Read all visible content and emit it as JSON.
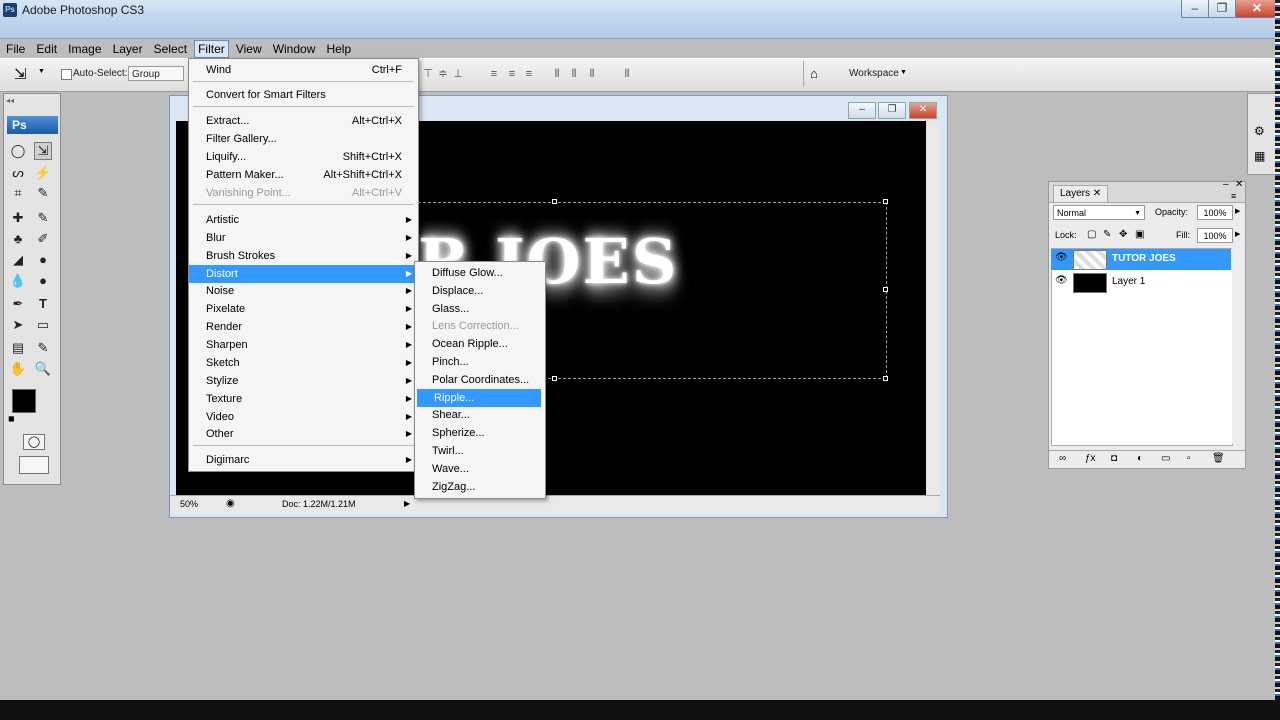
{
  "window": {
    "title": "Adobe Photoshop CS3",
    "app_badge": "Ps"
  },
  "menubar": [
    "File",
    "Edit",
    "Image",
    "Layer",
    "Select",
    "Filter",
    "View",
    "Window",
    "Help"
  ],
  "options": {
    "auto_select_label": "Auto-Select:",
    "auto_select_value": "Group",
    "workspace_label": "Workspace"
  },
  "tools": {
    "logo": "Ps"
  },
  "filter_menu": {
    "items": [
      {
        "label": "Wind",
        "shortcut": "Ctrl+F"
      },
      {
        "label": "Convert for Smart Filters"
      },
      {
        "label": "Extract...",
        "shortcut": "Alt+Ctrl+X"
      },
      {
        "label": "Filter Gallery..."
      },
      {
        "label": "Liquify...",
        "shortcut": "Shift+Ctrl+X"
      },
      {
        "label": "Pattern Maker...",
        "shortcut": "Alt+Shift+Ctrl+X"
      },
      {
        "label": "Vanishing Point...",
        "shortcut": "Alt+Ctrl+V"
      },
      {
        "label": "Artistic"
      },
      {
        "label": "Blur"
      },
      {
        "label": "Brush Strokes"
      },
      {
        "label": "Distort"
      },
      {
        "label": "Noise"
      },
      {
        "label": "Pixelate"
      },
      {
        "label": "Render"
      },
      {
        "label": "Sharpen"
      },
      {
        "label": "Sketch"
      },
      {
        "label": "Stylize"
      },
      {
        "label": "Texture"
      },
      {
        "label": "Video"
      },
      {
        "label": "Other"
      },
      {
        "label": "Digimarc"
      }
    ]
  },
  "distort_submenu": {
    "items": [
      "Diffuse Glow...",
      "Displace...",
      "Glass...",
      "Lens Correction...",
      "Ocean Ripple...",
      "Pinch...",
      "Polar Coordinates...",
      "Ripple...",
      "Shear...",
      "Spherize...",
      "Twirl...",
      "Wave...",
      "ZigZag..."
    ],
    "highlighted": "Ripple..."
  },
  "document": {
    "canvas_text": "R JOES",
    "zoom": "50%",
    "doc_info": "Doc: 1.22M/1.21M"
  },
  "layers_panel": {
    "tab": "Layers",
    "blend_mode": "Normal",
    "opacity_label": "Opacity:",
    "opacity": "100%",
    "lock_label": "Lock:",
    "fill_label": "Fill:",
    "fill": "100%",
    "layers": [
      {
        "name": "TUTOR JOES",
        "selected": true
      },
      {
        "name": "Layer 1",
        "selected": false
      }
    ]
  },
  "colors": {
    "highlight": "#3399ff",
    "titlebar": "#c2d6ee"
  }
}
